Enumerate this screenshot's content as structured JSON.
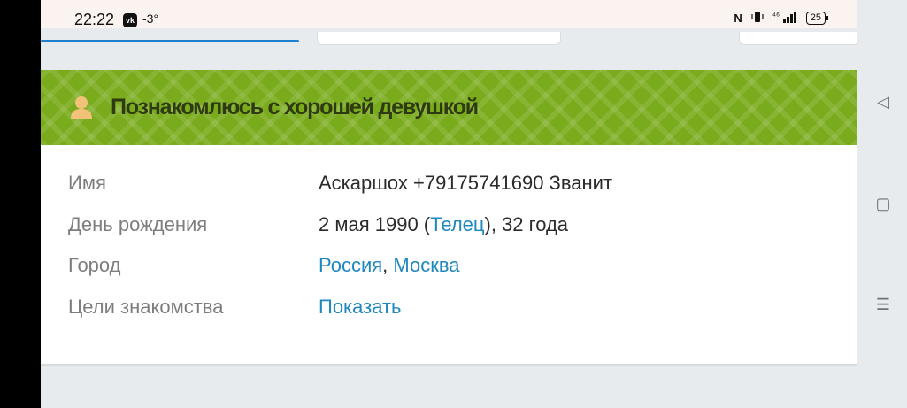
{
  "status_bar": {
    "time": "22:22",
    "vk_badge": "vk",
    "temperature": "-3°",
    "nfc": "N",
    "signal": "⁴⁶",
    "battery": "25"
  },
  "nav_bar": {
    "back_icon": "◁",
    "home_icon": "▢",
    "menu_icon": "☰"
  },
  "banner": {
    "title": "Познакомлюсь с хорошей девушкой",
    "icon": "person-icon",
    "color": "#7aab1d"
  },
  "profile": {
    "name": {
      "label": "Имя",
      "value": "Аскаршох +79175741690 Званит"
    },
    "birthday": {
      "label": "День рождения",
      "date": "2 мая 1990 (",
      "zodiac": "Телец",
      "age": "), 32 года"
    },
    "city": {
      "label": "Город",
      "country": "Россия",
      "separator": ", ",
      "city": "Москва"
    },
    "goals": {
      "label": "Цели знакомства",
      "action": "Показать"
    }
  },
  "accent_color": "#1f87bf"
}
